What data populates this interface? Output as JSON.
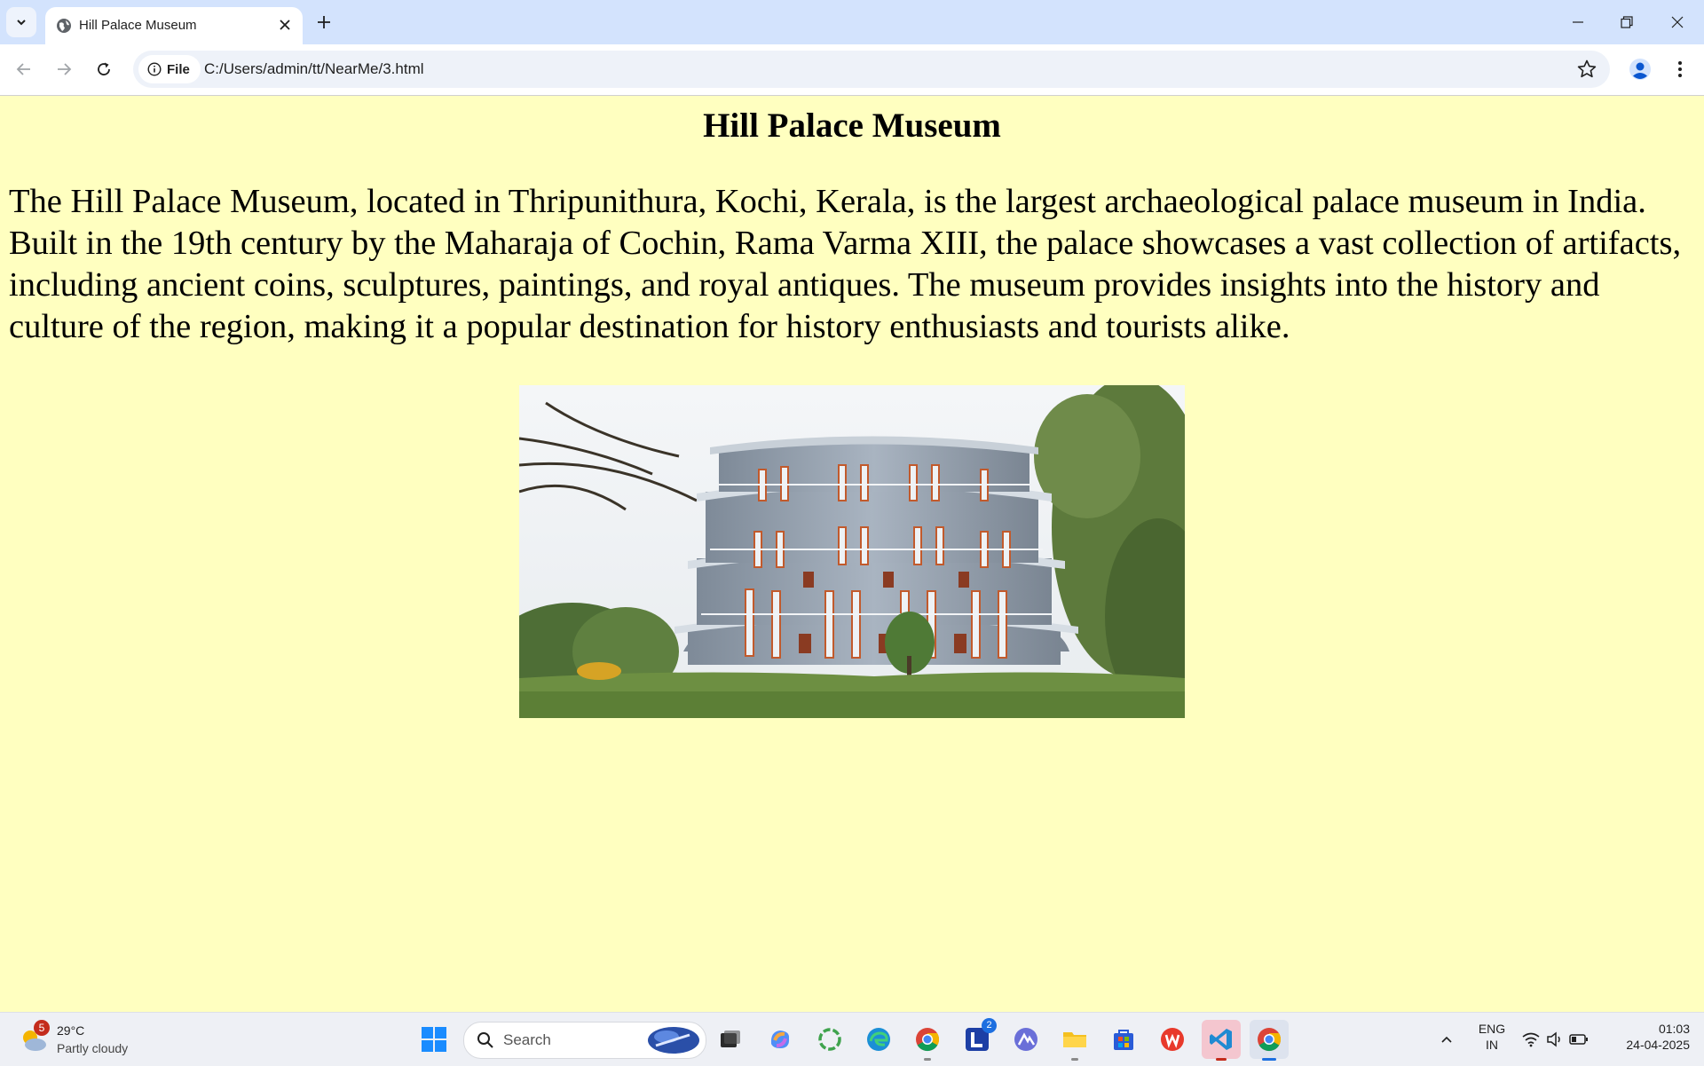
{
  "browser": {
    "tab_title": "Hill Palace Museum",
    "url_chip_label": "File",
    "url": "C:/Users/admin/tt/NearMe/3.html"
  },
  "page": {
    "heading": "Hill Palace Museum",
    "description": "The Hill Palace Museum, located in Thripunithura, Kochi, Kerala, is the largest archaeological palace museum in India. Built in the 19th century by the Maharaja of Cochin, Rama Varma XIII, the palace showcases a vast collection of artifacts, including ancient coins, sculptures, paintings, and royal antiques. The museum provides insights into the history and culture of the region, making it a popular destination for history enthusiasts and tourists alike.",
    "background_color": "#ffffc0"
  },
  "taskbar": {
    "weather_temp": "29°C",
    "weather_desc": "Partly cloudy",
    "weather_badge": "5",
    "search_placeholder": "Search",
    "lark_badge": "2",
    "lang_line1": "ENG",
    "lang_line2": "IN",
    "time": "01:03",
    "date": "24-04-2025"
  }
}
